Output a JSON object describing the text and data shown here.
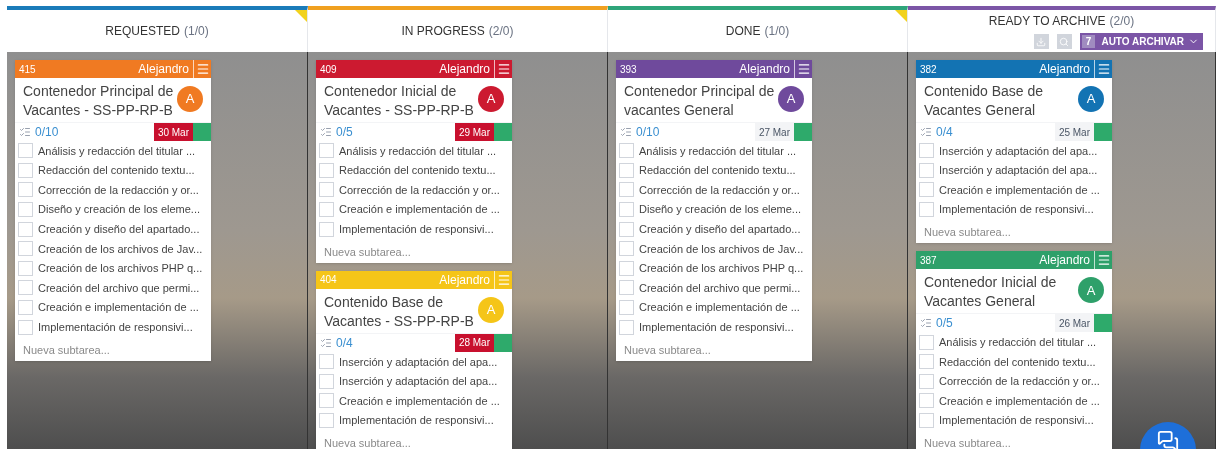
{
  "columns": [
    {
      "title": "REQUESTED",
      "count": "(1/0)",
      "color": "#1a7bb9",
      "flagged": true,
      "cards": [
        {
          "number": "415",
          "assignee": "Alejandro",
          "avatar": "A",
          "color": "#f07a22",
          "title": "Contenedor Principal de Vacantes - SS-PP-RP-B",
          "progress": "0/10",
          "complete": false,
          "date": "30 Mar",
          "overdue": true,
          "subtasks": [
            {
              "text": "Análisis y redacción del titular ...",
              "checked": false
            },
            {
              "text": "Redacción del contenido textu...",
              "checked": false
            },
            {
              "text": "Corrección de la redacción y or...",
              "checked": false
            },
            {
              "text": "Diseño y creación de los eleme...",
              "checked": false
            },
            {
              "text": "Creación y diseño del apartado...",
              "checked": false
            },
            {
              "text": "Creación de los archivos de Jav...",
              "checked": false
            },
            {
              "text": "Creación de los archivos PHP q...",
              "checked": false
            },
            {
              "text": "Creación del archivo que permi...",
              "checked": false
            },
            {
              "text": "Creación e implementación de ...",
              "checked": false
            },
            {
              "text": "Implementación de responsivi...",
              "checked": false
            }
          ],
          "placeholder": "Nueva subtarea..."
        }
      ]
    },
    {
      "title": "IN PROGRESS",
      "count": "(2/0)",
      "color": "#f0a020",
      "flagged": false,
      "cards": [
        {
          "number": "409",
          "assignee": "Alejandro",
          "avatar": "A",
          "color": "#cc1a30",
          "title": "Contenedor Inicial de Vacantes - SS-PP-RP-B",
          "progress": "0/5",
          "complete": false,
          "date": "29 Mar",
          "overdue": true,
          "subtasks": [
            {
              "text": "Análisis y redacción del titular ...",
              "checked": false
            },
            {
              "text": "Redacción del contenido textu...",
              "checked": false
            },
            {
              "text": "Corrección de la redacción y or...",
              "checked": false
            },
            {
              "text": "Creación e implementación de ...",
              "checked": false
            },
            {
              "text": "Implementación de responsivi...",
              "checked": false
            }
          ],
          "placeholder": "Nueva subtarea..."
        },
        {
          "number": "404",
          "assignee": "Alejandro",
          "avatar": "A",
          "color": "#f5c518",
          "title": "Contenido Base de Vacantes - SS-PP-RP-B",
          "progress": "0/4",
          "complete": false,
          "date": "28 Mar",
          "overdue": true,
          "subtasks": [
            {
              "text": "Inserción y adaptación del apa...",
              "checked": false
            },
            {
              "text": "Inserción y adaptación del apa...",
              "checked": false
            },
            {
              "text": "Creación e implementación de ...",
              "checked": false
            },
            {
              "text": "Implementación de responsivi...",
              "checked": false
            }
          ],
          "placeholder": "Nueva subtarea..."
        }
      ]
    },
    {
      "title": "DONE",
      "count": "(1/0)",
      "color": "#2ea57a",
      "flagged": true,
      "cards": [
        {
          "number": "393",
          "assignee": "Alejandro",
          "avatar": "A",
          "color": "#6f4a9c",
          "title": "Contenedor Principal de vacantes General",
          "progress": "0/10",
          "complete": false,
          "date": "27 Mar",
          "overdue": false,
          "subtasks": [
            {
              "text": "Análisis y redacción del titular ...",
              "checked": false
            },
            {
              "text": "Redacción del contenido textu...",
              "checked": false
            },
            {
              "text": "Corrección de la redacción y or...",
              "checked": false
            },
            {
              "text": "Diseño y creación de los eleme...",
              "checked": false
            },
            {
              "text": "Creación y diseño del apartado...",
              "checked": false
            },
            {
              "text": "Creación de los archivos de Jav...",
              "checked": false
            },
            {
              "text": "Creación de los archivos PHP q...",
              "checked": false
            },
            {
              "text": "Creación del archivo que permi...",
              "checked": false
            },
            {
              "text": "Creación e implementación de ...",
              "checked": false
            },
            {
              "text": "Implementación de responsivi...",
              "checked": false
            }
          ],
          "placeholder": "Nueva subtarea..."
        }
      ]
    },
    {
      "title": "READY TO ARCHIVE",
      "count": "(2/0)",
      "color": "#7b55a6",
      "flagged": false,
      "toolbar": {
        "badge": "7",
        "action": "AUTO ARCHIVAR"
      },
      "cards": [
        {
          "number": "382",
          "assignee": "Alejandro",
          "avatar": "A",
          "color": "#1373b3",
          "title": "Contenido Base de Vacantes General",
          "progress": "0/4",
          "complete": false,
          "date": "25 Mar",
          "overdue": false,
          "subtasks": [
            {
              "text": "Inserción y adaptación del apa...",
              "checked": false
            },
            {
              "text": "Inserción y adaptación del apa...",
              "checked": false
            },
            {
              "text": "Creación e implementación de ...",
              "checked": false
            },
            {
              "text": "Implementación de responsivi...",
              "checked": false
            }
          ],
          "placeholder": "Nueva subtarea..."
        },
        {
          "number": "387",
          "assignee": "Alejandro",
          "avatar": "A",
          "color": "#2ea06a",
          "title": "Contenedor Inicial de Vacantes General",
          "progress": "0/5",
          "complete": false,
          "date": "26 Mar",
          "overdue": false,
          "subtasks": [
            {
              "text": "Análisis y redacción del titular ...",
              "checked": false
            },
            {
              "text": "Redacción del contenido textu...",
              "checked": false
            },
            {
              "text": "Corrección de la redacción y or...",
              "checked": false
            },
            {
              "text": "Creación e implementación de ...",
              "checked": false
            },
            {
              "text": "Implementación de responsivi...",
              "checked": false
            }
          ],
          "placeholder": "Nueva subtarea..."
        }
      ]
    }
  ]
}
